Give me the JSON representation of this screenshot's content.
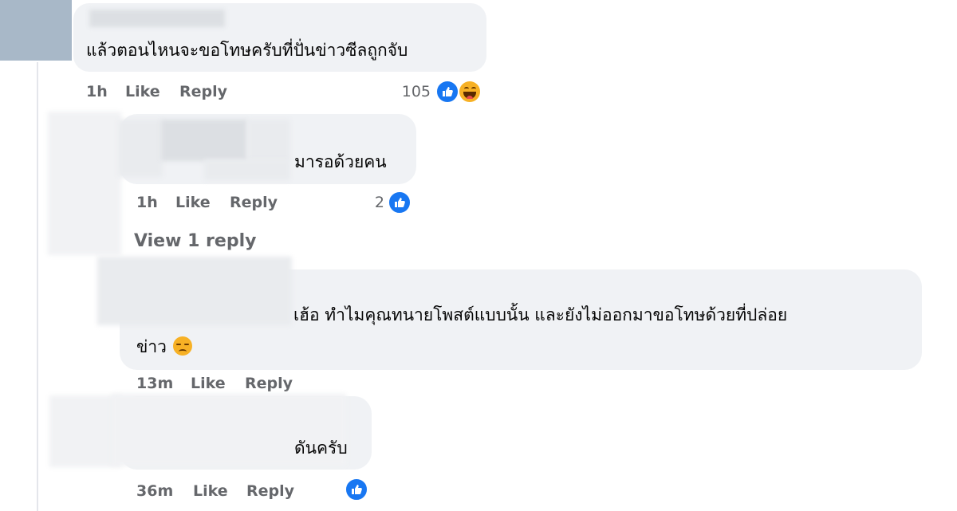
{
  "comments": [
    {
      "text": "แล้วตอนไหนจะขอโทษครับที่ปั่นข่าวซีลถูกจับ",
      "time": "1h",
      "like": "Like",
      "reply": "Reply",
      "reaction_count": "105",
      "reactions": [
        "like-icon",
        "haha-icon"
      ]
    },
    {
      "text": "มารอด้วยคน",
      "time": "1h",
      "like": "Like",
      "reply": "Reply",
      "reaction_count": "2",
      "reactions": [
        "like-icon"
      ],
      "view_replies": "View 1 reply"
    },
    {
      "text_line1": "เฮ้อ ทำไมคุณทนายโพสต์แบบนั้น และยังไม่ออกมาขอโทษด้วยที่ปล่อย",
      "text_line2": "ข่าว",
      "emoji": "downcast-face-emoji",
      "time": "13m",
      "like": "Like",
      "reply": "Reply"
    },
    {
      "text": "ดันครับ",
      "time": "36m",
      "like": "Like",
      "reply": "Reply",
      "reactions": [
        "like-icon"
      ]
    }
  ],
  "colors": {
    "bubble": "#f0f2f5",
    "meta_text": "#65676b",
    "like_blue": "#1877f2",
    "haha_yellow": "#f7b125"
  }
}
